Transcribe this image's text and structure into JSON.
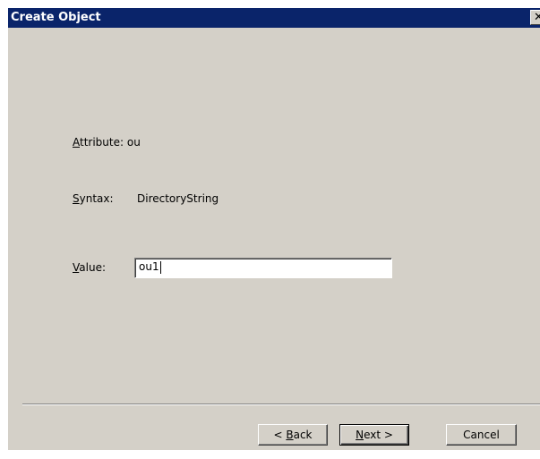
{
  "window": {
    "title": "Create Object",
    "close_glyph": "✕"
  },
  "form": {
    "attribute_label_prefix": "A",
    "attribute_label_rest": "ttribute:",
    "attribute_value": "ou",
    "syntax_label_prefix": "S",
    "syntax_label_rest": "yntax:",
    "syntax_value": "DirectoryString",
    "value_label_prefix": "V",
    "value_label_rest": "alue:",
    "value_input": "ou1"
  },
  "buttons": {
    "back_pre": "< ",
    "back_ul": "B",
    "back_rest": "ack",
    "next_ul": "N",
    "next_rest": "ext >",
    "cancel": "Cancel"
  },
  "icons": {
    "close": "close-icon"
  },
  "colors": {
    "titlebar": "#0a246a",
    "face": "#d4d0c8"
  }
}
